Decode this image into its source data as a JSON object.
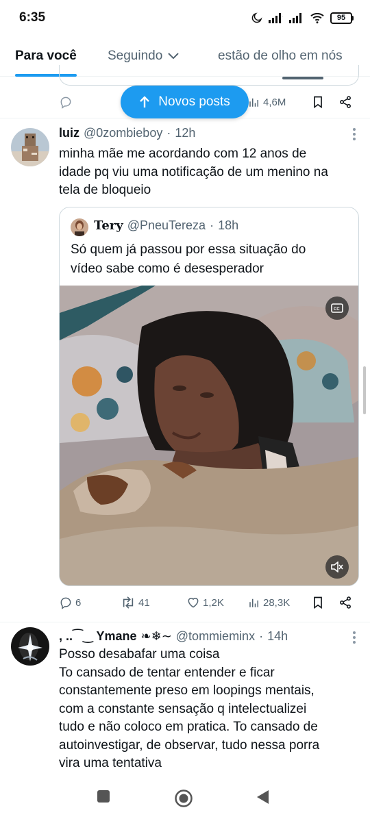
{
  "status_bar": {
    "time": "6:35",
    "battery": "95"
  },
  "tabs": [
    {
      "label": "Para você"
    },
    {
      "label": "Seguindo"
    },
    {
      "label": "estão de olho em nós"
    }
  ],
  "prev_post": {
    "views": "4,6M"
  },
  "new_posts_button": {
    "label": "Novos posts"
  },
  "tweet1": {
    "name": "luiz",
    "handle": "@0zombieboy",
    "time": "12h",
    "text": "minha mãe me acordando com 12 anos de\nidade pq viu uma notificação de um menino na\ntela de bloqueio",
    "quote": {
      "name": "Tery",
      "handle": "@PneuTereza",
      "time": "18h",
      "text": "Só quem já passou por essa situação do\nvídeo sabe como é desesperador"
    },
    "actions": {
      "replies": "6",
      "reposts": "41",
      "likes": "1,2K",
      "views": "28,3K"
    }
  },
  "tweet2": {
    "name": ", ..⁀‿ Ymane",
    "name_suffix": "❧❄∼",
    "handle": "@tommieminx",
    "time": "14h",
    "text": "Posso desabafar uma coisa\nTo cansado de tentar entender e ficar\nconstantemente preso em loopings mentais,\ncom a constante sensação q intelectualizei\ntudo e não coloco em pratica. To cansado de\nautoinvestigar, de observar, tudo nessa porra\nvira uma tentativa"
  },
  "colors": {
    "accent": "#1d9bf0",
    "text": "#0f1419",
    "secondary": "#536471"
  },
  "icons": [
    "moon-icon",
    "signal-icon",
    "wifi-icon",
    "battery-icon",
    "chevron-down-icon",
    "arrow-up-icon",
    "reply-icon",
    "repost-icon",
    "like-icon",
    "views-icon",
    "bookmark-icon",
    "share-icon",
    "more-icon",
    "cc-icon",
    "mute-icon",
    "home-nav-icon",
    "back-nav-icon",
    "recents-nav-icon"
  ]
}
